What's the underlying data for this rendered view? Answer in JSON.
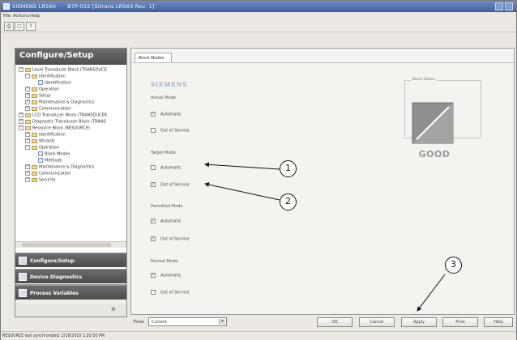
{
  "window": {
    "title": "SIEMENS LR560",
    "subtitle": "B7P-032 [Sitrans LR560 Rev. 1]"
  },
  "menu": [
    "File",
    "Actions",
    "Help"
  ],
  "left_panel": {
    "header": "Configure/Setup",
    "tree": [
      "Level Transducer Block (TRANSDUCE",
      "Identification",
      "Identification",
      "Operation",
      "Setup",
      "Maintenance & Diagnostics",
      "Communication",
      "LCD Transducer Block (TRANSDUCER",
      "Diagnostic Transducer Block (TRANS",
      "Resource Block (RESOURCE)",
      "Identification",
      "Wizards",
      "Operation",
      "Block Modes",
      "Methods",
      "Maintenance & Diagnostics",
      "Communication",
      "Security"
    ],
    "nav": [
      "Configure/Setup",
      "Device Diagnostics",
      "Process Variables"
    ]
  },
  "right_panel": {
    "tab": "Block Modes",
    "brand": "SIEMENS",
    "groups": [
      {
        "label": "Actual Mode",
        "options": [
          {
            "text": "Automatic",
            "checked": true
          },
          {
            "text": "Out of Service",
            "checked": false
          }
        ]
      },
      {
        "label": "Target Mode",
        "options": [
          {
            "text": "Automatic",
            "checked": false
          },
          {
            "text": "Out of Service",
            "checked": true
          }
        ]
      },
      {
        "label": "Permitted Mode",
        "options": [
          {
            "text": "Automatic",
            "checked": true
          },
          {
            "text": "Out of Service",
            "checked": true
          }
        ]
      },
      {
        "label": "Normal Mode",
        "options": [
          {
            "text": "Automatic",
            "checked": true
          },
          {
            "text": "Out of Service",
            "checked": false
          }
        ]
      }
    ],
    "block_status_legend": "Block Status",
    "status_text": "GOOD"
  },
  "callouts": [
    "1",
    "2",
    "3"
  ],
  "bottom": {
    "time_label": "Time",
    "time_value": "Current",
    "buttons": [
      "OK",
      "Cancel",
      "Apply",
      "Print",
      "Help"
    ]
  },
  "statusbar": "RESOURCE last synchronized: 2/16/2010 1:20:50 PM",
  "colors": {
    "brand": "#6d8da5",
    "status_grey": "#9a9a9a"
  }
}
